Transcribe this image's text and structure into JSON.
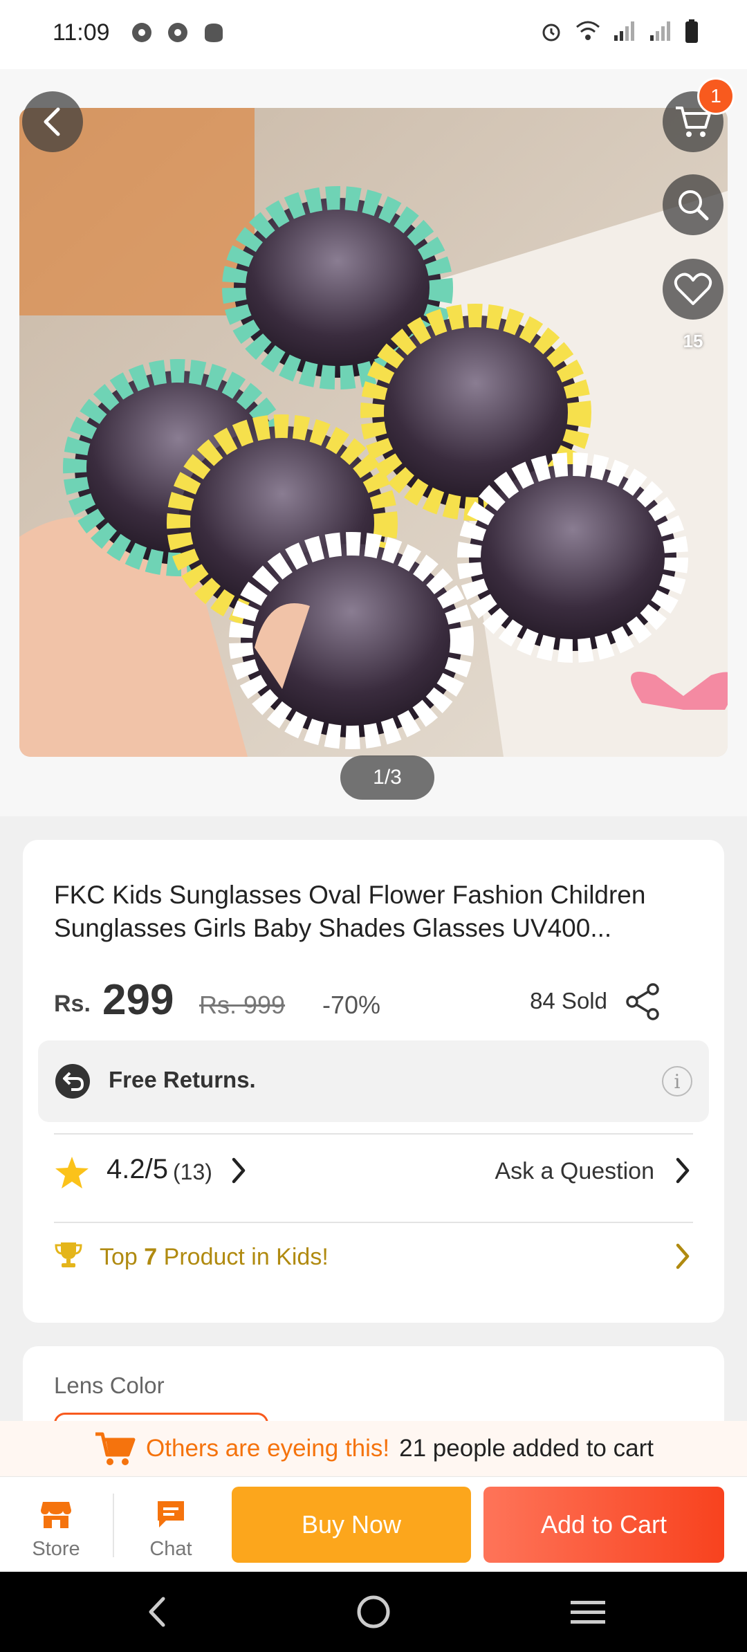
{
  "status_bar": {
    "time": "11:09"
  },
  "gallery": {
    "cart_count": "1",
    "wishlist_count": "15",
    "page_indicator": "1/3"
  },
  "product": {
    "title": "FKC Kids Sunglasses Oval Flower Fashion Children Sunglasses Girls Baby Shades Glasses UV400...",
    "currency": "Rs.",
    "price": "299",
    "original_price": "Rs. 999",
    "discount": "-70%",
    "sold": "84 Sold"
  },
  "returns": {
    "label": "Free Returns.",
    "info_glyph": "i"
  },
  "rating": {
    "value": "4.2/5",
    "count": "(13)",
    "ask_label": "Ask a Question"
  },
  "ranking": {
    "prefix": "Top",
    "rank": "7",
    "suffix": "Product in Kids!"
  },
  "variants": {
    "label": "Lens Color"
  },
  "urgency": {
    "highlight": "Others are eyeing this!",
    "text": "21 people added to cart"
  },
  "action_bar": {
    "store_label": "Store",
    "chat_label": "Chat",
    "buy_label": "Buy Now",
    "cart_label": "Add to Cart"
  },
  "colors": {
    "accent": "#f85a1e",
    "buy_now": "#fca61c",
    "rank_gold": "#b08a10",
    "star": "#fbc21a"
  }
}
